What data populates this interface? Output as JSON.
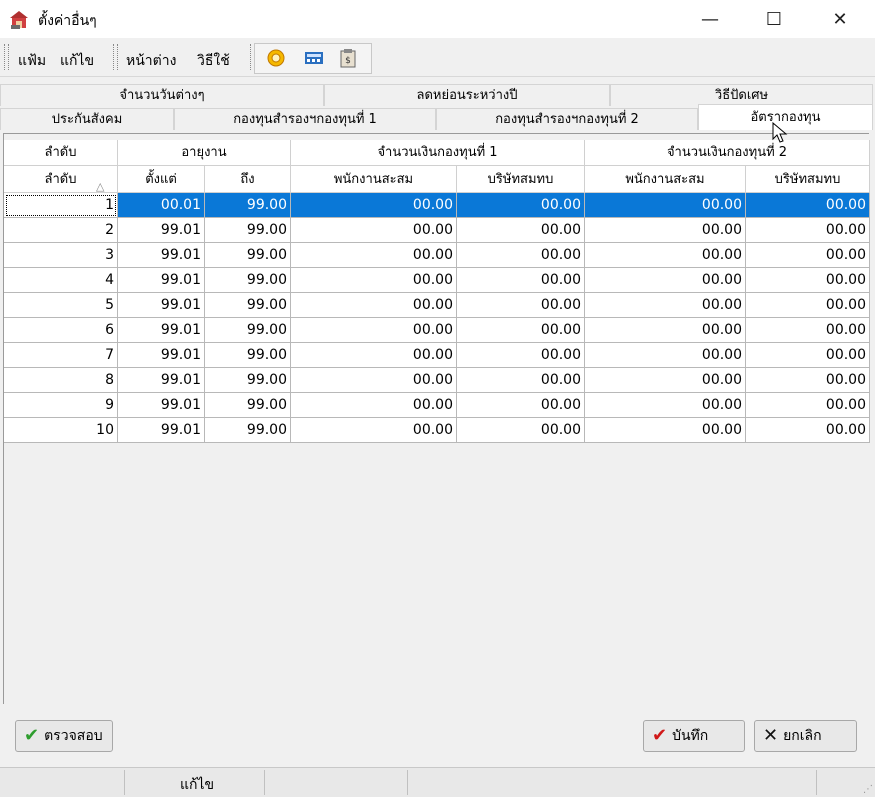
{
  "window": {
    "title": "ตั้งค่าอื่นๆ",
    "controls": {
      "minimize": "—",
      "maximize": "☐",
      "close": "✕"
    }
  },
  "menu": {
    "items": [
      "แฟ้ม",
      "แก้ไข",
      "หน้าต่าง",
      "วิธีใช้"
    ]
  },
  "toolbar": {
    "icons": [
      "help-circle-icon",
      "calculator-icon",
      "clipboard-icon"
    ]
  },
  "tabs": {
    "row1": [
      "จำนวนวันต่างๆ",
      "ลดหย่อนระหว่างปี",
      "วิธีปัดเศษ"
    ],
    "row2": [
      "ประกันสังคม",
      "กองทุนสำรองฯกองทุนที่ 1",
      "กองทุนสำรองฯกองทุนที่ 2",
      "อัตรากองทุน"
    ],
    "active": "อัตรากองทุน"
  },
  "grid": {
    "group_headers": {
      "seq": "ลำดับ",
      "age": "อายุงาน",
      "fund1": "จำนวนเงินกองทุนที่ 1",
      "fund2": "จำนวนเงินกองทุนที่ 2"
    },
    "columns": {
      "seq": "ลำดับ",
      "from": "ตั้งแต่",
      "to": "ถึง",
      "f1_emp": "พนักงานสะสม",
      "f1_co": "บริษัทสมทบ",
      "f2_emp": "พนักงานสะสม",
      "f2_co": "บริษัทสมทบ"
    },
    "sort_indicator": "△",
    "selected_row": 0,
    "rows": [
      {
        "seq": "1",
        "from": "00.01",
        "to": "99.00",
        "f1_emp": "00.00",
        "f1_co": "00.00",
        "f2_emp": "00.00",
        "f2_co": "00.00"
      },
      {
        "seq": "2",
        "from": "99.01",
        "to": "99.00",
        "f1_emp": "00.00",
        "f1_co": "00.00",
        "f2_emp": "00.00",
        "f2_co": "00.00"
      },
      {
        "seq": "3",
        "from": "99.01",
        "to": "99.00",
        "f1_emp": "00.00",
        "f1_co": "00.00",
        "f2_emp": "00.00",
        "f2_co": "00.00"
      },
      {
        "seq": "4",
        "from": "99.01",
        "to": "99.00",
        "f1_emp": "00.00",
        "f1_co": "00.00",
        "f2_emp": "00.00",
        "f2_co": "00.00"
      },
      {
        "seq": "5",
        "from": "99.01",
        "to": "99.00",
        "f1_emp": "00.00",
        "f1_co": "00.00",
        "f2_emp": "00.00",
        "f2_co": "00.00"
      },
      {
        "seq": "6",
        "from": "99.01",
        "to": "99.00",
        "f1_emp": "00.00",
        "f1_co": "00.00",
        "f2_emp": "00.00",
        "f2_co": "00.00"
      },
      {
        "seq": "7",
        "from": "99.01",
        "to": "99.00",
        "f1_emp": "00.00",
        "f1_co": "00.00",
        "f2_emp": "00.00",
        "f2_co": "00.00"
      },
      {
        "seq": "8",
        "from": "99.01",
        "to": "99.00",
        "f1_emp": "00.00",
        "f1_co": "00.00",
        "f2_emp": "00.00",
        "f2_co": "00.00"
      },
      {
        "seq": "9",
        "from": "99.01",
        "to": "99.00",
        "f1_emp": "00.00",
        "f1_co": "00.00",
        "f2_emp": "00.00",
        "f2_co": "00.00"
      },
      {
        "seq": "10",
        "from": "99.01",
        "to": "99.00",
        "f1_emp": "00.00",
        "f1_co": "00.00",
        "f2_emp": "00.00",
        "f2_co": "00.00"
      }
    ]
  },
  "buttons": {
    "verify": "ตรวจสอบ",
    "save": "บันทึก",
    "cancel": "ยกเลิก"
  },
  "status": {
    "mode": "แก้ไข"
  },
  "colors": {
    "selection": "#0a78d7",
    "check_green": "#2e9d2e",
    "save_red": "#d01818"
  }
}
